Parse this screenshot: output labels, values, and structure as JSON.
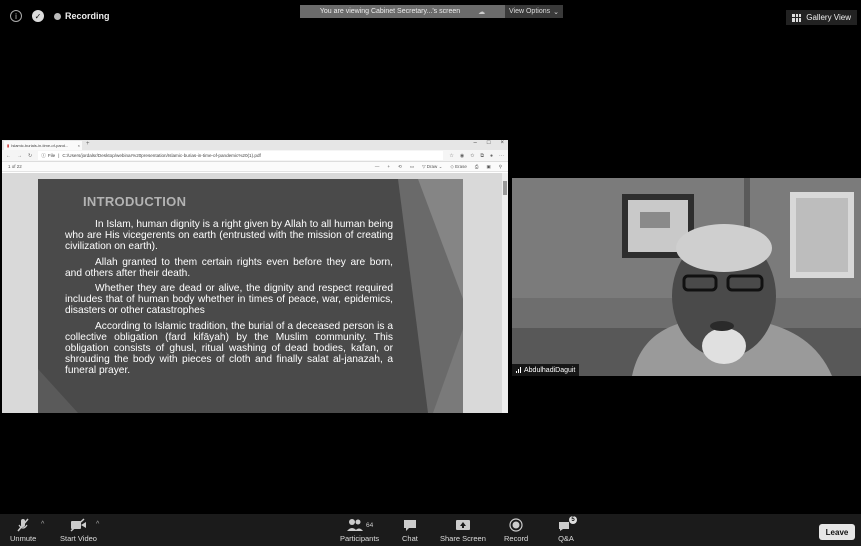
{
  "top": {
    "recording_label": "Recording",
    "banner_text": "You are viewing Cabinet Secretary...'s screen",
    "view_options": "View Options",
    "gallery_view": "Gallery View"
  },
  "browser": {
    "tab_title": "Islamic-burials-in-time-of-pand...",
    "url_prefix": "File",
    "url": "C:/Users/jordalsr/Desktop/webinar%20presentation/Islamic-burias-in-time-of-pandemic%20(1).pdf",
    "page_indicator": "of 22",
    "draw_label": "Draw",
    "erase_label": "Erase"
  },
  "slide": {
    "title": "INTRODUCTION",
    "paragraphs": [
      "In Islam, human dignity is a right given by Allah to all human being who are His vicegerents on earth (entrusted with the mission of creating civilization on earth).",
      "Allah granted to them certain rights even before they are born, and others after their death.",
      "Whether they are dead or alive, the dignity and respect required includes that of human body whether in times of peace, war, epidemics, disasters or other catastrophes",
      "According to Islamic tradition, the burial of a deceased person is a collective obligation (fard kifāyah) by the Muslim community. This obligation consists of ghusl, ritual washing of dead bodies, kafan, or shrouding the body with pieces of cloth and finally salat al-janazah, a funeral prayer."
    ]
  },
  "video": {
    "participant_name": "AbdulhadiDaguit"
  },
  "toolbar": {
    "unmute": "Unmute",
    "start_video": "Start Video",
    "participants": "Participants",
    "participants_count": "64",
    "chat": "Chat",
    "share_screen": "Share Screen",
    "record": "Record",
    "qa": "Q&A",
    "qa_badge": "5",
    "leave": "Leave"
  }
}
